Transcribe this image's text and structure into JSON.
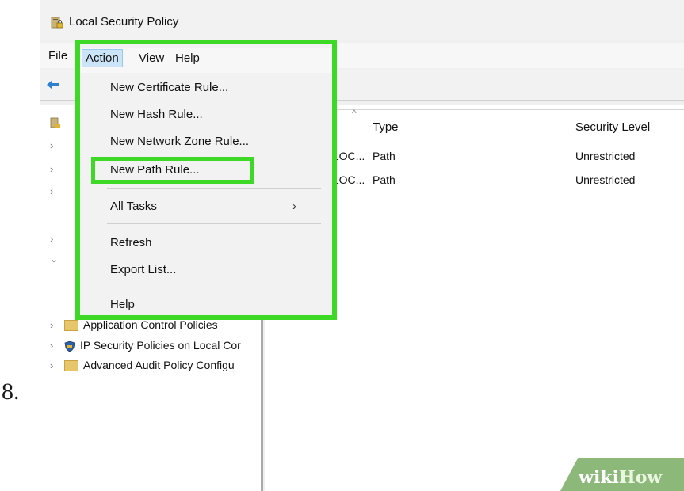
{
  "step_number": "8.",
  "window": {
    "title": "Local Security Policy",
    "icon": "security-policy-icon"
  },
  "menubar": {
    "file": "File",
    "action": "Action",
    "view": "View",
    "help": "Help"
  },
  "toolbar": {
    "back_icon": "back-arrow-icon"
  },
  "action_menu": {
    "items": [
      {
        "label": "New Certificate Rule..."
      },
      {
        "label": "New Hash Rule..."
      },
      {
        "label": "New Network Zone Rule..."
      },
      {
        "label": "New Path Rule..."
      },
      {
        "label": "All Tasks",
        "has_submenu": true
      },
      {
        "label": "Refresh"
      },
      {
        "label": "Export List..."
      },
      {
        "label": "Help"
      }
    ],
    "highlighted_item": "New Path Rule...",
    "highlight_color": "#3dd926"
  },
  "tree": {
    "rows": [
      {
        "label": "Application Control Policies",
        "icon": "folder-icon"
      },
      {
        "label": "IP Security Policies on Local Cor",
        "icon": "shield-network-icon"
      },
      {
        "label": "Advanced Audit Policy Configu",
        "icon": "folder-icon"
      }
    ]
  },
  "list": {
    "columns": [
      "Type",
      "Security Level"
    ],
    "rows": [
      {
        "name": "KEY_LOC...",
        "type": "Path",
        "security_level": "Unrestricted"
      },
      {
        "name": "KEY_LOC...",
        "type": "Path",
        "security_level": "Unrestricted"
      }
    ]
  },
  "watermark": {
    "wiki": "wiki",
    "how": "How",
    "color": "#8cb97a"
  }
}
